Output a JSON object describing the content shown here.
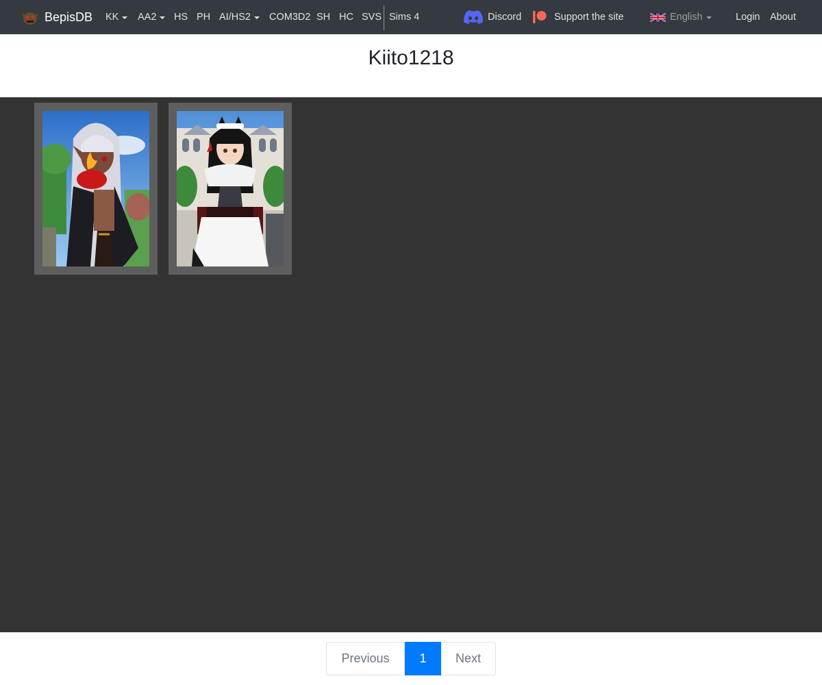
{
  "navbar": {
    "brand": "BepisDB",
    "items": [
      {
        "label": "KK",
        "dropdown": true
      },
      {
        "label": "AA2",
        "dropdown": true
      },
      {
        "label": "HS",
        "dropdown": false
      },
      {
        "label": "PH",
        "dropdown": false
      },
      {
        "label": "AI/HS2",
        "dropdown": true
      },
      {
        "label": "COM3D2",
        "dropdown": false
      },
      {
        "label": "SH",
        "dropdown": false
      },
      {
        "label": "HC",
        "dropdown": false
      },
      {
        "label": "SVS",
        "dropdown": false
      },
      {
        "label": "Sims 4",
        "dropdown": false
      }
    ],
    "discord": "Discord",
    "support": "Support the site",
    "language": "English",
    "login": "Login",
    "about": "About"
  },
  "page": {
    "title": "Kiito1218"
  },
  "gallery": {
    "cards": [
      {
        "icon": "character-card-thumbnail",
        "theme": "silver-haired elf with flame"
      },
      {
        "icon": "character-card-thumbnail",
        "theme": "black-haired maid with cat ears"
      }
    ]
  },
  "pagination": {
    "previous": "Previous",
    "current": "1",
    "next": "Next"
  },
  "colors": {
    "navbar_bg": "#343a40",
    "gallery_bg": "#333333",
    "card_frame": "#5e5e5e",
    "active_page": "#007bff",
    "patreon_red": "#f96854",
    "discord_blurple": "#5865f2"
  }
}
